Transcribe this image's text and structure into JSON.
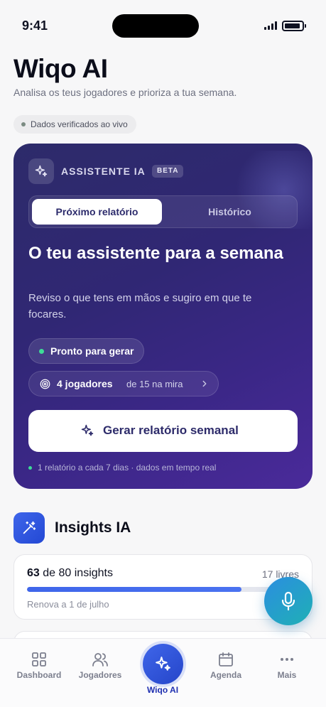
{
  "status_bar": {
    "time": "9:41"
  },
  "header": {
    "title": "Wiqo AI",
    "subtitle": "Analisa os teus jogadores e prioriza a tua semana.",
    "verified_label": "Dados verificados ao vivo"
  },
  "assistant": {
    "label": "ASSISTENTE IA",
    "badge": "BETA",
    "tabs": [
      {
        "label": "Próximo relatório",
        "active": true
      },
      {
        "label": "Histórico",
        "active": false
      }
    ],
    "title": "O teu assistente para a semana",
    "description": "Reviso o que tens em mãos e sugiro em que te focares.",
    "status": "Pronto para gerar",
    "target_count": "4 jogadores",
    "target_rest": "de 15 na mira",
    "generate_label": "Gerar relatório semanal",
    "footer": "1 relatório a cada 7 dias · dados em tempo real"
  },
  "insights": {
    "title": "Insights IA",
    "used": "63",
    "total_text": "de 80 insights",
    "free": "17 livres",
    "progress": 0.7875,
    "renew": "Renova a 1 de julho"
  },
  "tab_bar": {
    "items": [
      {
        "label": "Dashboard",
        "icon": "grid-icon"
      },
      {
        "label": "Jogadores",
        "icon": "users-icon"
      },
      {
        "label": "Wiqo AI",
        "icon": "sparkles-icon",
        "active": true
      },
      {
        "label": "Agenda",
        "icon": "calendar-icon"
      },
      {
        "label": "Mais",
        "icon": "more-icon"
      }
    ]
  },
  "colors": {
    "accent": "#3f66ea",
    "hero_start": "#2d2b6a",
    "hero_end": "#4a2a9a",
    "status_green": "#3ddc97",
    "mic_start": "#2b8ee0",
    "mic_end": "#1fb0b5"
  }
}
